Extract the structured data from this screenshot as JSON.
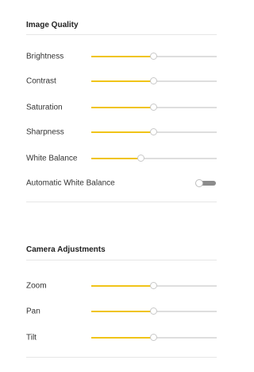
{
  "image_quality": {
    "title": "Image Quality",
    "sliders": [
      {
        "id": "brightness",
        "label": "Brightness",
        "value": 0.5
      },
      {
        "id": "contrast",
        "label": "Contrast",
        "value": 0.5
      },
      {
        "id": "saturation",
        "label": "Saturation",
        "value": 0.5
      },
      {
        "id": "sharpness",
        "label": "Sharpness",
        "value": 0.5
      },
      {
        "id": "white-balance",
        "label": "White Balance",
        "value": 0.4
      }
    ],
    "toggle": {
      "label": "Automatic White Balance",
      "on": false
    }
  },
  "camera_adjustments": {
    "title": "Camera Adjustments",
    "sliders": [
      {
        "id": "zoom",
        "label": "Zoom",
        "value": 0.5
      },
      {
        "id": "pan",
        "label": "Pan",
        "value": 0.5
      },
      {
        "id": "tilt",
        "label": "Tilt",
        "value": 0.5
      }
    ]
  },
  "colors": {
    "accent": "#f0c419",
    "track": "#dedede",
    "toggle_off": "#8c8c8c"
  }
}
